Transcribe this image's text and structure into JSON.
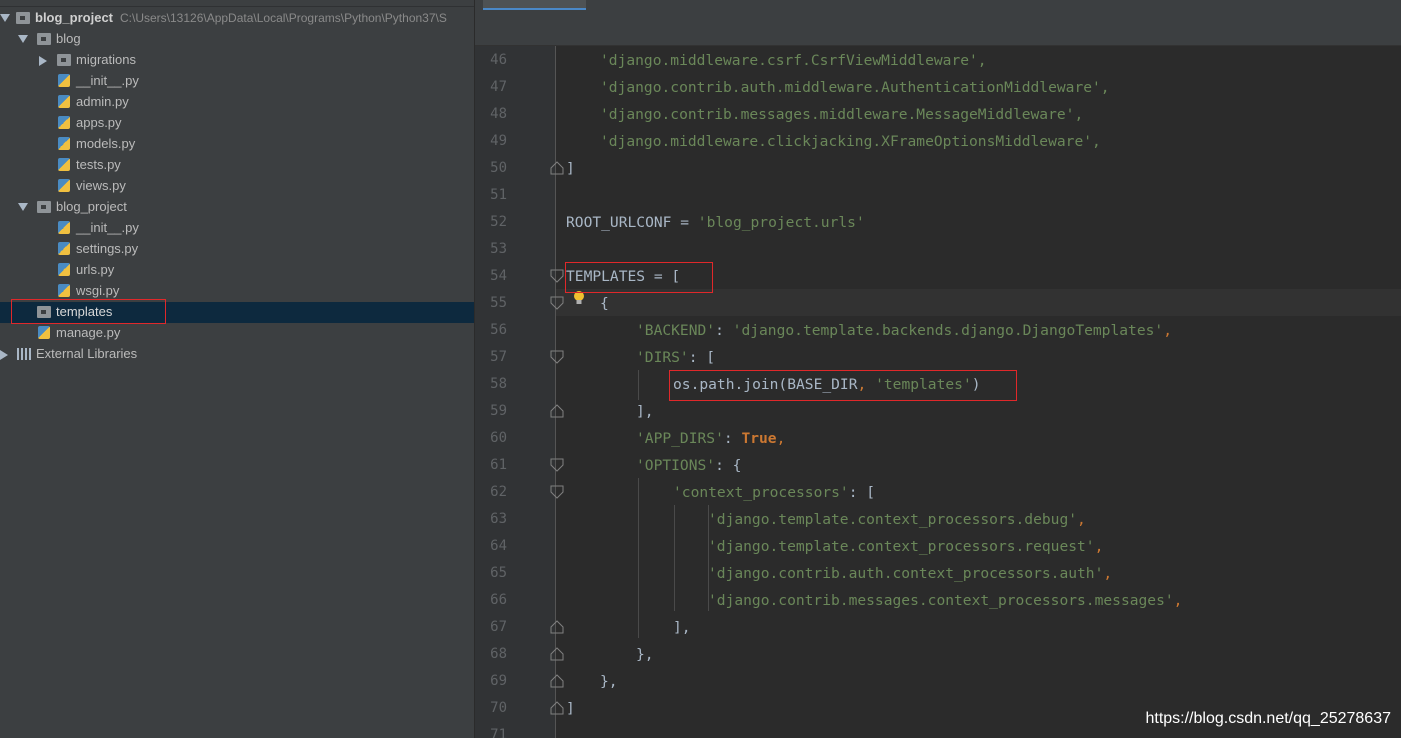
{
  "project_tree": {
    "root_label": "blog_project",
    "root_path": "C:\\Users\\13126\\AppData\\Local\\Programs\\Python\\Python37\\S",
    "items": [
      {
        "label": "blog"
      },
      {
        "label": "migrations"
      },
      {
        "label": "__init__.py"
      },
      {
        "label": "admin.py"
      },
      {
        "label": "apps.py"
      },
      {
        "label": "models.py"
      },
      {
        "label": "tests.py"
      },
      {
        "label": "views.py"
      },
      {
        "label": "blog_project"
      },
      {
        "label": "__init__.py"
      },
      {
        "label": "settings.py"
      },
      {
        "label": "urls.py"
      },
      {
        "label": "wsgi.py"
      },
      {
        "label": "templates"
      },
      {
        "label": "manage.py"
      },
      {
        "label": "External Libraries"
      }
    ]
  },
  "editor": {
    "line_numbers": [
      "46",
      "47",
      "48",
      "49",
      "50",
      "51",
      "52",
      "53",
      "54",
      "55",
      "56",
      "57",
      "58",
      "59",
      "60",
      "61",
      "62",
      "63",
      "64",
      "65",
      "66",
      "67",
      "68",
      "69",
      "70",
      "71"
    ],
    "lines": {
      "l46": "'django.middleware.csrf.CsrfViewMiddleware',",
      "l47": "'django.contrib.auth.middleware.AuthenticationMiddleware',",
      "l48": "'django.contrib.messages.middleware.MessageMiddleware',",
      "l49": "'django.middleware.clickjacking.XFrameOptionsMiddleware',",
      "l50": "]",
      "l52a": "ROOT_URLCONF = ",
      "l52b": "'blog_project.urls'",
      "l54": "TEMPLATES = [",
      "l55": "{",
      "l56a": "'BACKEND'",
      "l56b": ": ",
      "l56c": "'django.template.backends.django.DjangoTemplates'",
      "l56d": ",",
      "l57a": "'DIRS'",
      "l57b": ": [",
      "l58a": "os.path.join(BASE_DIR",
      "l58b": ", ",
      "l58c": "'templates'",
      "l58d": ")",
      "l59": "],",
      "l60a": "'APP_DIRS'",
      "l60b": ": ",
      "l60c": "True",
      "l60d": ",",
      "l61a": "'OPTIONS'",
      "l61b": ": {",
      "l62a": "'context_processors'",
      "l62b": ": [",
      "l63": "'django.template.context_processors.debug'",
      "l64": "'django.template.context_processors.request'",
      "l65": "'django.contrib.auth.context_processors.auth'",
      "l66": "'django.contrib.messages.context_processors.messages'",
      "comma": ",",
      "l67": "],",
      "l68": "},",
      "l69": "},",
      "l70": "]"
    }
  },
  "watermark": "https://blog.csdn.net/qq_25278637",
  "colors": {
    "sidebar_bg": "#3c3f41",
    "editor_bg": "#2b2b2b",
    "selection": "#0d293e",
    "string": "#6a8759",
    "keyword": "#cc7832",
    "highlight_box": "#e0282a"
  }
}
